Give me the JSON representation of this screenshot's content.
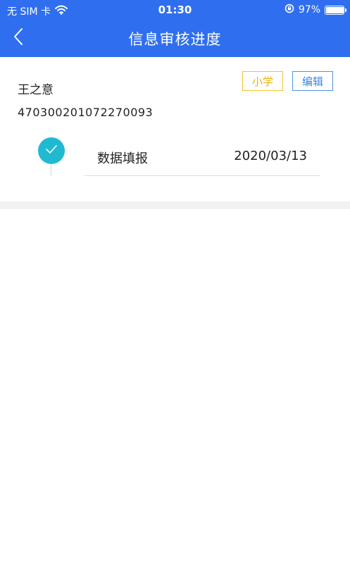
{
  "status_bar": {
    "carrier": "无 SIM 卡",
    "time": "01:30",
    "battery_percent": "97%",
    "battery_level": 0.97
  },
  "nav": {
    "title": "信息审核进度"
  },
  "student": {
    "name": "王之意",
    "id_number": "470300201072270093",
    "grade_badge": "小学",
    "edit_label": "编辑"
  },
  "progress": {
    "steps": [
      {
        "label": "数据填报",
        "date": "2020/03/13",
        "done": true
      }
    ]
  },
  "colors": {
    "header": "#2f6fef",
    "step_done": "#1fbad2",
    "grade_badge": "#f0b400",
    "edit": "#3d86df"
  },
  "icons": {
    "back": "chevron-left-icon",
    "wifi": "wifi-icon",
    "orientation_lock": "orientation-lock-icon",
    "battery": "battery-icon",
    "check": "check-icon"
  }
}
